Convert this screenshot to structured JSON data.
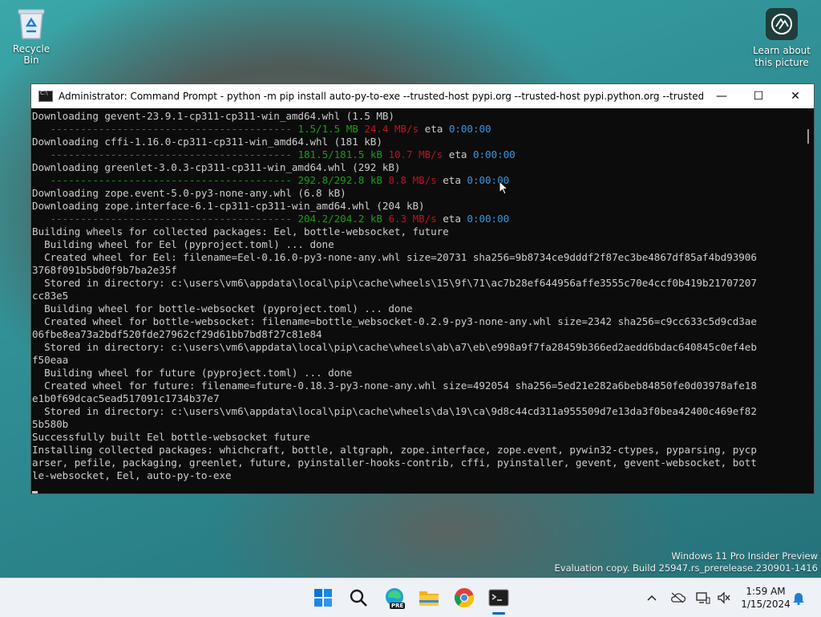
{
  "desktop": {
    "recycle_bin_label": "Recycle Bin",
    "learn_label_1": "Learn about",
    "learn_label_2": "this picture"
  },
  "window": {
    "title": "Administrator: Command Prompt - python  -m pip install auto-py-to-exe --trusted-host pypi.org --trusted-host pypi.python.org --trusted-host files.pyt...",
    "minimize_glyph": "—",
    "maximize_glyph": "☐",
    "close_glyph": "✕"
  },
  "terminal": {
    "lines": [
      {
        "t": "Downloading gevent-23.9.1-cp311-cp311-win_amd64.whl (1.5 MB)"
      },
      {
        "bar": "   ----------------------------------------",
        "prog": "1.5/1.5 MB",
        "rate": "24.4 MB/s",
        "eta_label": "eta",
        "eta": "0:00:00"
      },
      {
        "t": "Downloading cffi-1.16.0-cp311-cp311-win_amd64.whl (181 kB)"
      },
      {
        "bar": "   ----------------------------------------",
        "prog": "181.5/181.5 kB",
        "rate": "10.7 MB/s",
        "eta_label": "eta",
        "eta": "0:00:00"
      },
      {
        "t": "Downloading greenlet-3.0.3-cp311-cp311-win_amd64.whl (292 kB)"
      },
      {
        "bar": "   ----------------------------------------",
        "prog": "292.8/292.8 kB",
        "rate": "8.8 MB/s",
        "eta_label": "eta",
        "eta": "0:00:00"
      },
      {
        "t": "Downloading zope.event-5.0-py3-none-any.whl (6.8 kB)"
      },
      {
        "t": "Downloading zope.interface-6.1-cp311-cp311-win_amd64.whl (204 kB)"
      },
      {
        "bar": "   ----------------------------------------",
        "prog": "204.2/204.2 kB",
        "rate": "6.3 MB/s",
        "eta_label": "eta",
        "eta": "0:00:00"
      },
      {
        "t": "Building wheels for collected packages: Eel, bottle-websocket, future"
      },
      {
        "t": "  Building wheel for Eel (pyproject.toml) ... done"
      },
      {
        "t": "  Created wheel for Eel: filename=Eel-0.16.0-py3-none-any.whl size=20731 sha256=9b8734ce9dddf2f87ec3be4867df85af4bd93906"
      },
      {
        "t": "3768f091b5bd0f9b7ba2e35f"
      },
      {
        "t": "  Stored in directory: c:\\users\\vm6\\appdata\\local\\pip\\cache\\wheels\\15\\9f\\71\\ac7b28ef644956affe3555c70e4ccf0b419b21707207"
      },
      {
        "t": "cc83e5"
      },
      {
        "t": "  Building wheel for bottle-websocket (pyproject.toml) ... done"
      },
      {
        "t": "  Created wheel for bottle-websocket: filename=bottle_websocket-0.2.9-py3-none-any.whl size=2342 sha256=c9cc633c5d9cd3ae"
      },
      {
        "t": "06fbe8ea73a2bdf520fde27962cf29d61bb7bd8f27c81e84"
      },
      {
        "t": "  Stored in directory: c:\\users\\vm6\\appdata\\local\\pip\\cache\\wheels\\ab\\a7\\eb\\e998a9f7fa28459b366ed2aedd6bdac640845c0ef4eb"
      },
      {
        "t": "f50eaa"
      },
      {
        "t": "  Building wheel for future (pyproject.toml) ... done"
      },
      {
        "t": "  Created wheel for future: filename=future-0.18.3-py3-none-any.whl size=492054 sha256=5ed21e282a6beb84850fe0d03978afe18"
      },
      {
        "t": "e1b0f69dcac5ead517091c1734b37e7"
      },
      {
        "t": "  Stored in directory: c:\\users\\vm6\\appdata\\local\\pip\\cache\\wheels\\da\\19\\ca\\9d8c44cd311a955509d7e13da3f0bea42400c469ef82"
      },
      {
        "t": "5b580b"
      },
      {
        "t": "Successfully built Eel bottle-websocket future"
      },
      {
        "t": "Installing collected packages: whichcraft, bottle, altgraph, zope.interface, zope.event, pywin32-ctypes, pyparsing, pycp"
      },
      {
        "t": "arser, pefile, packaging, greenlet, future, pyinstaller-hooks-contrib, cffi, pyinstaller, gevent, gevent-websocket, bott"
      },
      {
        "t": "le-websocket, Eel, auto-py-to-exe"
      }
    ]
  },
  "watermark": {
    "line1": "Windows 11 Pro Insider Preview",
    "line2": "Evaluation copy. Build 25947.rs_prerelease.230901-1416"
  },
  "taskbar": {
    "icons": [
      "windows-start-icon",
      "search-icon",
      "edge-pre-icon",
      "file-explorer-icon",
      "chrome-icon",
      "terminal-icon"
    ],
    "edge_badge": "PRE",
    "time": "1:59 AM",
    "date": "1/15/2024",
    "colors": {
      "accent": "#0067c0"
    }
  }
}
